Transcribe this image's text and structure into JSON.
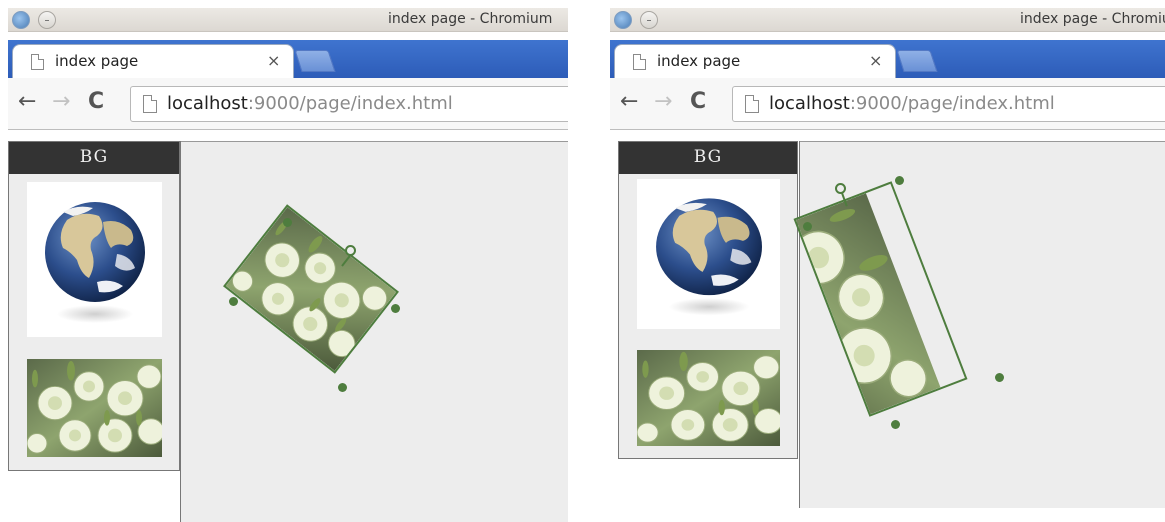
{
  "windows": [
    {
      "window_title": "index page - Chromium",
      "tab_title": "index page",
      "tab_close": "×",
      "url_host": "localhost",
      "url_rest": ":9000/page/index.html",
      "sidebar_title": "BG"
    },
    {
      "window_title": "index page - Chromium",
      "tab_title": "index page",
      "tab_close": "×",
      "url_host": "localhost",
      "url_rest": ":9000/page/index.html",
      "sidebar_title": "BG"
    }
  ],
  "icons": {
    "back": "←",
    "forward": "→",
    "reload": "C"
  },
  "colors": {
    "selection_outline": "#4e7d3e",
    "canvas_background": "#ededed",
    "tab_strip": "#3f74cf"
  }
}
